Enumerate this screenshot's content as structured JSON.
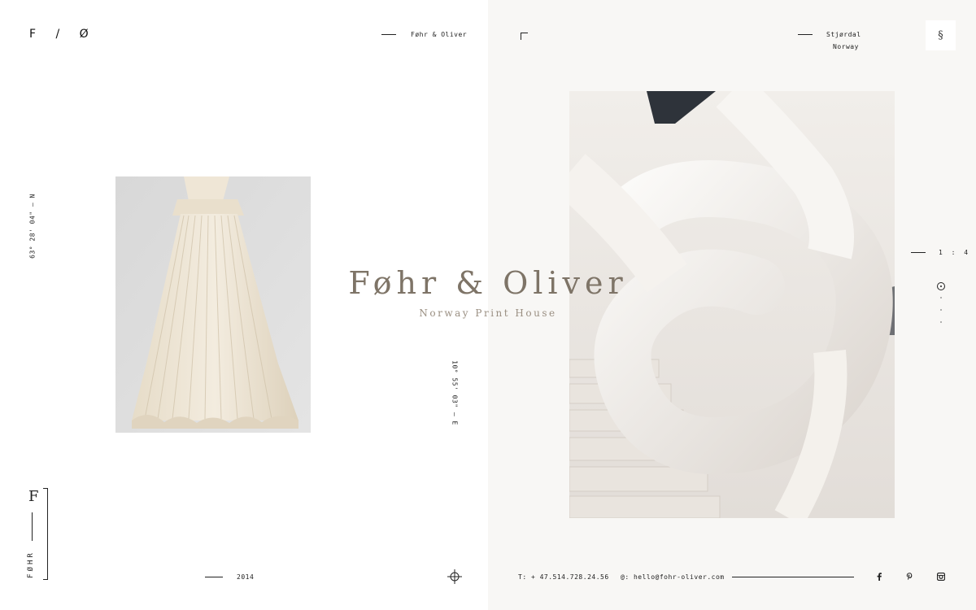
{
  "header": {
    "logo": "F / Ø",
    "brand": "Føhr & Oliver",
    "location_city": "Stjørdal",
    "location_country": "Norway",
    "menu_glyph": "§"
  },
  "coordinates": {
    "latitude": "63° 28' 04\" — N",
    "longitude": "10° 55' 03\" — E"
  },
  "hero": {
    "title": "Føhr & Oliver",
    "subtitle": "Norway Print House"
  },
  "slider": {
    "counter": "1 : 4",
    "dots": [
      "active",
      "inactive",
      "inactive",
      "inactive"
    ]
  },
  "side_brand": {
    "monogram": "F",
    "vertical_text": "FØHR"
  },
  "footer": {
    "year": "2014",
    "phone": "T: + 47.514.728.24.56",
    "email": "@: hello@fohr-oliver.com",
    "social": [
      "facebook-icon",
      "pinterest-icon",
      "instagram-icon"
    ]
  },
  "colors": {
    "title": "#7e7467",
    "right_pane": "#f8f7f5",
    "text": "#222222"
  }
}
